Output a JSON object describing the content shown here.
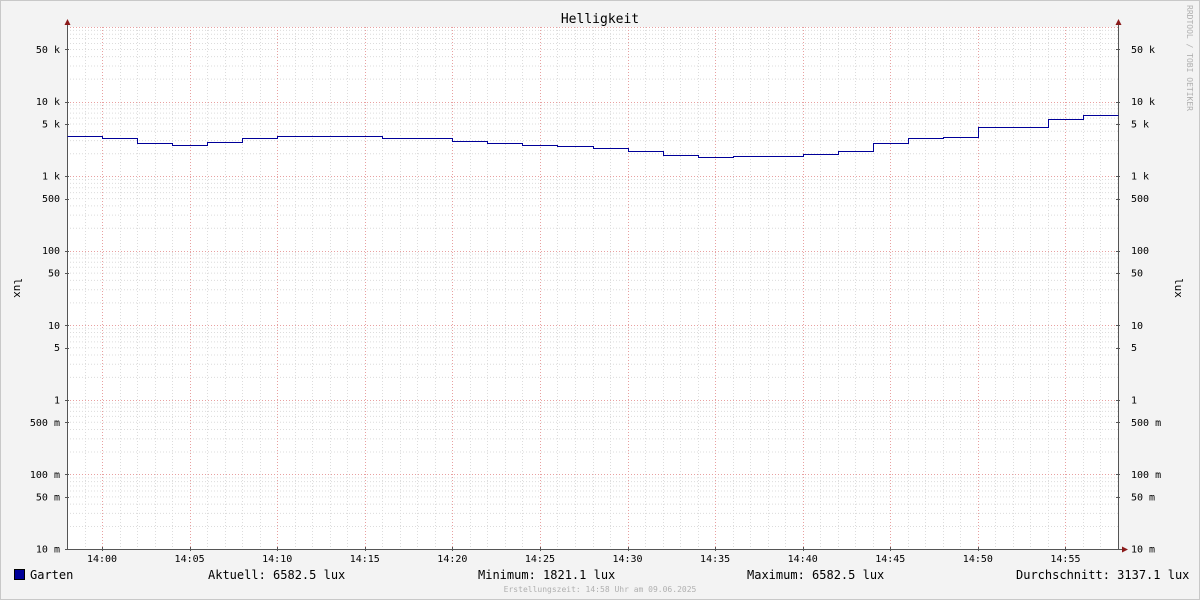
{
  "chart_data": {
    "type": "line",
    "title": "Helligkeit",
    "ylabel": "lux",
    "y_scale": "log",
    "ylim": [
      0.01,
      100000
    ],
    "y_ticks": [
      {
        "value": 50000,
        "label": "50 k"
      },
      {
        "value": 10000,
        "label": "10 k"
      },
      {
        "value": 5000,
        "label": "5 k"
      },
      {
        "value": 1000,
        "label": "1 k"
      },
      {
        "value": 500,
        "label": "500"
      },
      {
        "value": 100,
        "label": "100"
      },
      {
        "value": 50,
        "label": "50"
      },
      {
        "value": 10,
        "label": "10"
      },
      {
        "value": 5,
        "label": "5"
      },
      {
        "value": 1,
        "label": "1"
      },
      {
        "value": 0.5,
        "label": "500 m"
      },
      {
        "value": 0.1,
        "label": "100 m"
      },
      {
        "value": 0.05,
        "label": "50 m"
      },
      {
        "value": 0.01,
        "label": "10 m"
      }
    ],
    "x_range": [
      "13:58",
      "14:58"
    ],
    "x_ticks": [
      "14:00",
      "14:05",
      "14:10",
      "14:15",
      "14:20",
      "14:25",
      "14:30",
      "14:35",
      "14:40",
      "14:45",
      "14:50",
      "14:55"
    ],
    "grid": true,
    "series": [
      {
        "name": "Garten",
        "color": "#000099",
        "steps": [
          {
            "x": "13:58",
            "y": 3500
          },
          {
            "x": "14:00",
            "y": 3200
          },
          {
            "x": "14:02",
            "y": 2750
          },
          {
            "x": "14:04",
            "y": 2650
          },
          {
            "x": "14:06",
            "y": 2900
          },
          {
            "x": "14:08",
            "y": 3200
          },
          {
            "x": "14:10",
            "y": 3500
          },
          {
            "x": "14:16",
            "y": 3200
          },
          {
            "x": "14:20",
            "y": 2950
          },
          {
            "x": "14:22",
            "y": 2750
          },
          {
            "x": "14:24",
            "y": 2600
          },
          {
            "x": "14:26",
            "y": 2500
          },
          {
            "x": "14:28",
            "y": 2400
          },
          {
            "x": "14:30",
            "y": 2150
          },
          {
            "x": "14:32",
            "y": 1900
          },
          {
            "x": "14:34",
            "y": 1821.1
          },
          {
            "x": "14:36",
            "y": 1850
          },
          {
            "x": "14:40",
            "y": 2000
          },
          {
            "x": "14:42",
            "y": 2200
          },
          {
            "x": "14:44",
            "y": 2750
          },
          {
            "x": "14:46",
            "y": 3200
          },
          {
            "x": "14:48",
            "y": 3400
          },
          {
            "x": "14:50",
            "y": 4500
          },
          {
            "x": "14:54",
            "y": 5900
          },
          {
            "x": "14:56",
            "y": 6582.5
          },
          {
            "x": "14:58",
            "y": 6582.5
          }
        ]
      }
    ]
  },
  "legend": {
    "series_name": "Garten",
    "current": "Aktuell: 6582.5 lux",
    "minimum": "Minimum: 1821.1 lux",
    "maximum": "Maximum: 6582.5 lux",
    "average": "Durchschnitt: 3137.1 lux"
  },
  "watermark": "RRDTOOL / TOBI OETIKER",
  "footer": "Erstellungszeit: 14:58 Uhr am 09.06.2025"
}
